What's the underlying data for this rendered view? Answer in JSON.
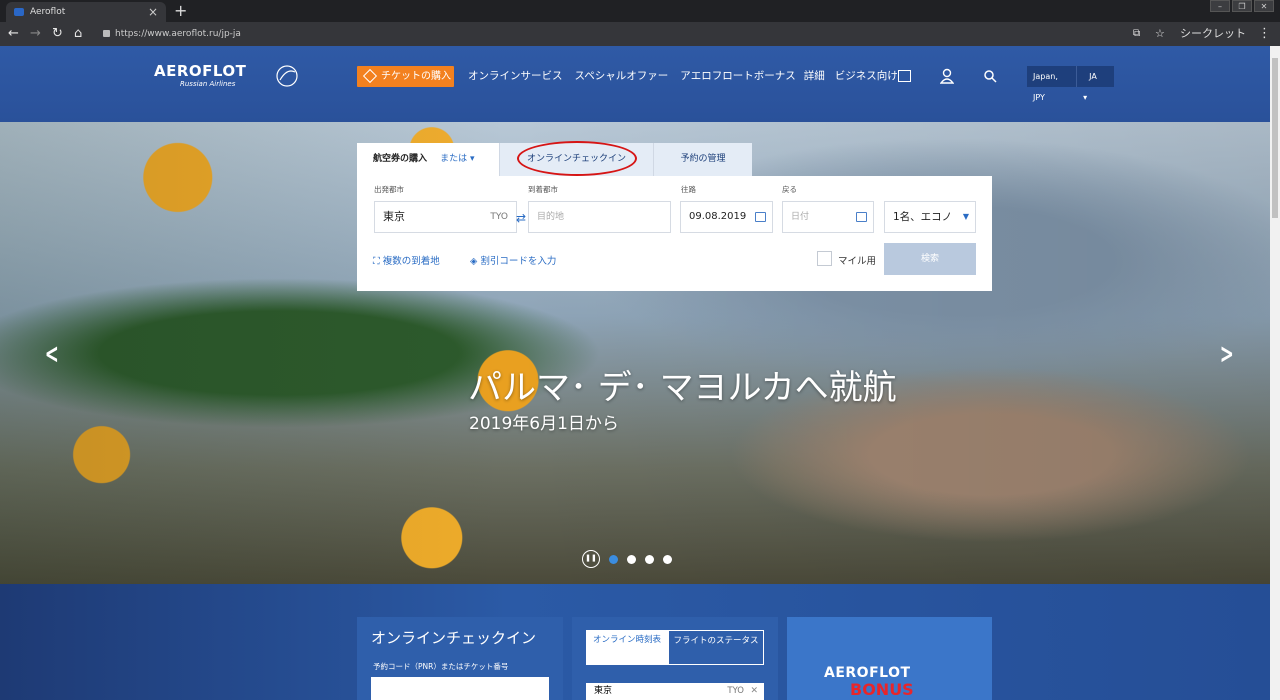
{
  "browser": {
    "tab_title": "Aeroflot",
    "url": "https://www.aeroflot.ru/jp-ja",
    "incognito_label": "シークレット"
  },
  "header": {
    "logo_text": "AEROFLOT",
    "logo_sub": "Russian Airlines",
    "buy_button": "チケットの購入",
    "nav": [
      "オンラインサービス",
      "スペシャルオファー",
      "アエロフロートボーナス",
      "詳細",
      "ビジネス向け"
    ],
    "region": "Japan, JPY",
    "language": "JA"
  },
  "booking": {
    "tabs": {
      "buy": "航空券の購入",
      "or": "または ▾",
      "checkin": "オンラインチェックイン",
      "manage": "予約の管理"
    },
    "labels": {
      "from": "出発都市",
      "to": "到着都市",
      "depart": "往路",
      "return": "戻る"
    },
    "from_value": "東京",
    "from_code": "TYO",
    "to_placeholder": "目的地",
    "depart_value": "09.08.2019",
    "return_placeholder": "日付",
    "passengers": "1名、エコノ",
    "multi_city": "複数の到着地",
    "promo": "割引コードを入力",
    "miles": "マイル用",
    "search": "検索"
  },
  "hero": {
    "title": "パルマ･ デ･ マヨルカへ就航",
    "subtitle": "2019年6月1日から",
    "slides": 4,
    "active_slide": 1
  },
  "bottom": {
    "checkin_title": "オンラインチェックイン",
    "checkin_label": "予約コード（PNR）またはチケット番号",
    "timetable_tab": "オンライン時刻表",
    "status_tab": "フライトのステータス",
    "timetable_from": "東京",
    "timetable_code": "TYO",
    "bonus_logo": "AEROFLOT",
    "bonus_word": "BONUS"
  },
  "colors": {
    "brand_blue": "#2f5aa6",
    "accent_orange": "#f3811f",
    "highlight_circle": "#d61515"
  }
}
